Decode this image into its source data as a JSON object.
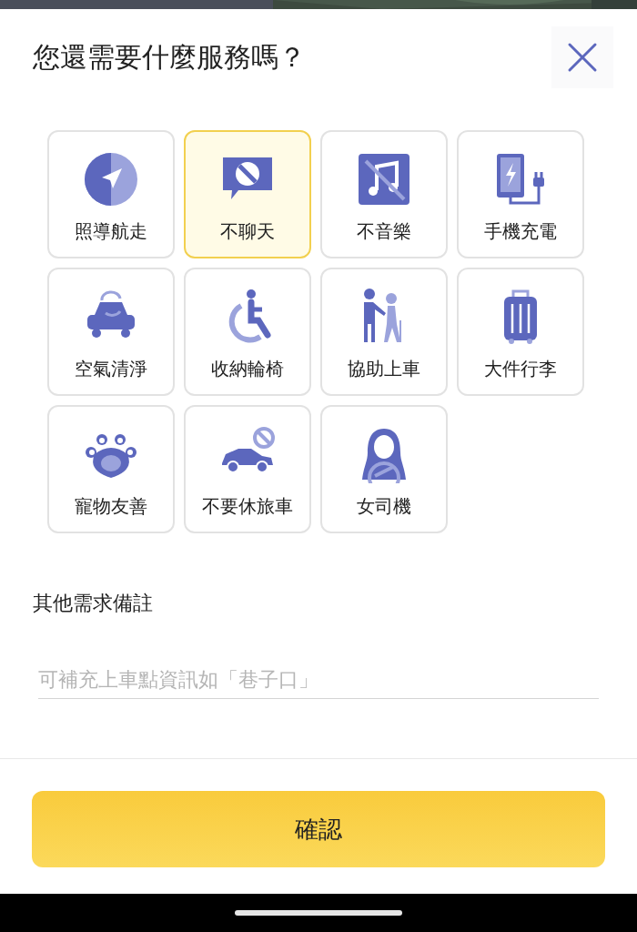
{
  "title": "您還需要什麼服務嗎？",
  "options": [
    {
      "label": "照導航走",
      "selected": false
    },
    {
      "label": "不聊天",
      "selected": true
    },
    {
      "label": "不音樂",
      "selected": false
    },
    {
      "label": "手機充電",
      "selected": false
    },
    {
      "label": "空氣清淨",
      "selected": false
    },
    {
      "label": "收納輪椅",
      "selected": false
    },
    {
      "label": "協助上車",
      "selected": false
    },
    {
      "label": "大件行李",
      "selected": false
    },
    {
      "label": "寵物友善",
      "selected": false
    },
    {
      "label": "不要休旅車",
      "selected": false
    },
    {
      "label": "女司機",
      "selected": false
    }
  ],
  "note": {
    "label": "其他需求備註",
    "placeholder": "可補充上車點資訊如「巷子口」"
  },
  "confirm_button": "確認"
}
